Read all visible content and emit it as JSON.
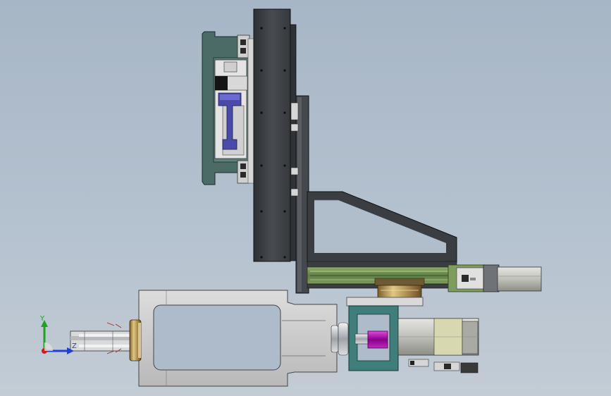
{
  "triad": {
    "y_label": "Y",
    "z_label": "Z",
    "y_color": "#1aa51a",
    "z_color": "#1f3fd6",
    "x_color": "#d21c1c"
  },
  "colors": {
    "background": "#aebbca",
    "plate_dark": "#3d4146",
    "bracket_teal": "#4b6b66",
    "slide_green": "#6d8e4f",
    "frame_gray": "#c8c8c8",
    "mount_teal": "#3f7e7b",
    "coupling_magenta": "#b000b0",
    "piston_blue": "#4a4aa8",
    "pad_gold": "#c9b25a"
  }
}
